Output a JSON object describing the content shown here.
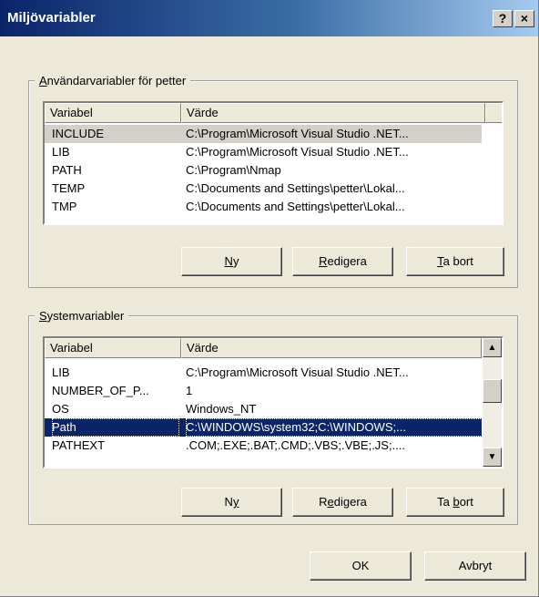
{
  "window": {
    "title": "Miljövariabler",
    "help_glyph": "?",
    "close_glyph": "×"
  },
  "user_group": {
    "legend_prefix": "A",
    "legend_rest": "nvändarvariabler för petter",
    "columns": [
      "Variabel",
      "Värde"
    ],
    "rows": [
      {
        "name": "INCLUDE",
        "value": "C:\\Program\\Microsoft Visual Studio .NET..."
      },
      {
        "name": "LIB",
        "value": "C:\\Program\\Microsoft Visual Studio .NET..."
      },
      {
        "name": "PATH",
        "value": "C:\\Program\\Nmap"
      },
      {
        "name": "TEMP",
        "value": "C:\\Documents and Settings\\petter\\Lokal..."
      },
      {
        "name": "TMP",
        "value": "C:\\Documents and Settings\\petter\\Lokal..."
      }
    ],
    "buttons": {
      "new_ul": "N",
      "new_rest": "y",
      "edit_ul": "R",
      "edit_rest": "edigera",
      "delete_ul": "T",
      "delete_rest": "a bort"
    }
  },
  "system_group": {
    "legend_prefix": "S",
    "legend_rest": "ystemvariabler",
    "columns": [
      "Variabel",
      "Värde"
    ],
    "rows": [
      {
        "name": "LIB",
        "value": "C:\\Program\\Microsoft Visual Studio .NET..."
      },
      {
        "name": "NUMBER_OF_P...",
        "value": "1"
      },
      {
        "name": "OS",
        "value": "Windows_NT"
      },
      {
        "name": "Path",
        "value": "C:\\WINDOWS\\system32;C:\\WINDOWS;..."
      },
      {
        "name": "PATHEXT",
        "value": ".COM;.EXE;.BAT;.CMD;.VBS;.VBE;.JS;...."
      }
    ],
    "scroll_up": "▲",
    "scroll_down": "▼",
    "buttons": {
      "new_pre": "N",
      "new_ul": "y",
      "edit_pre": "R",
      "edit_ul": "e",
      "edit_rest": "digera",
      "delete_pre": "Ta ",
      "delete_ul": "b",
      "delete_rest": "ort"
    }
  },
  "footer": {
    "ok": "OK",
    "cancel": "Avbryt"
  }
}
